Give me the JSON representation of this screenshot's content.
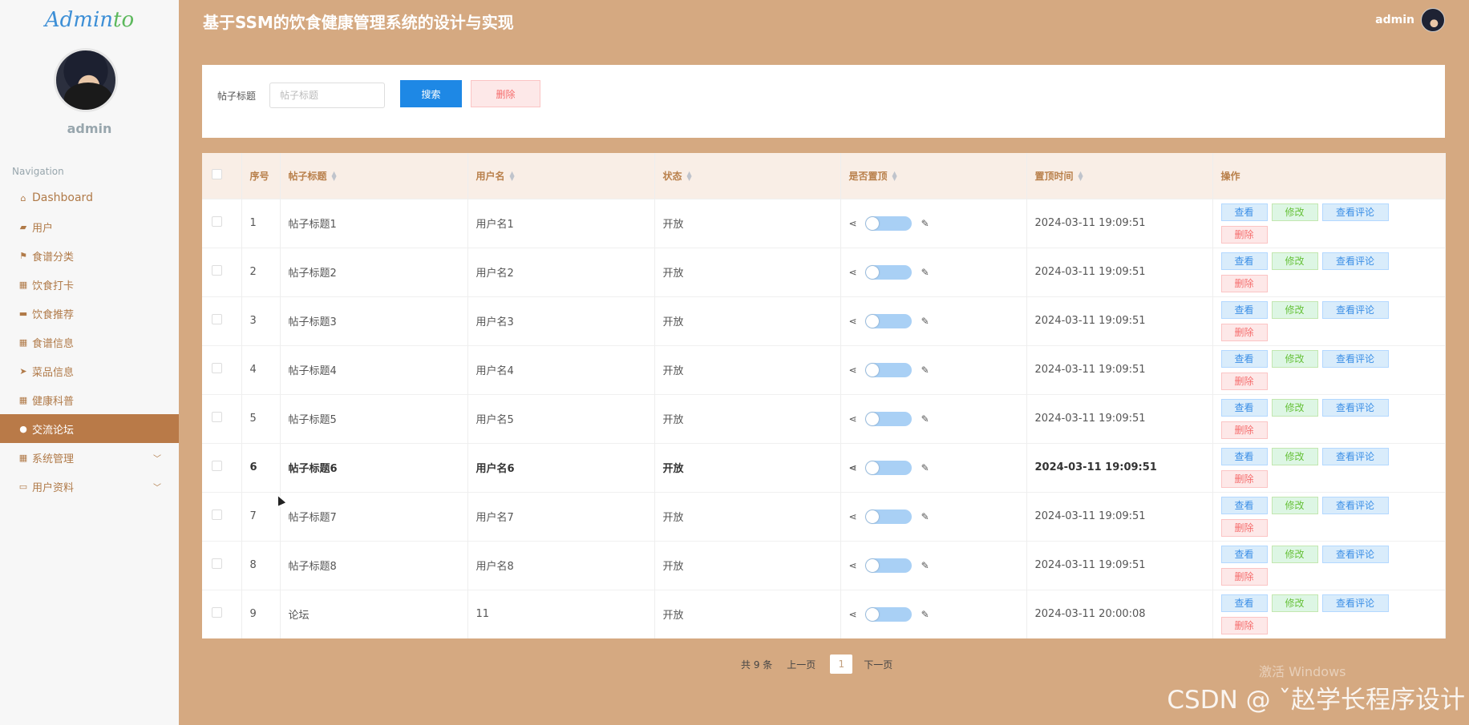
{
  "app": {
    "logo": "Adminto",
    "logo_main": "Admin",
    "logo_accent": "to",
    "title": "基于SSM的饮食健康管理系统的设计与实现"
  },
  "user": {
    "name": "admin"
  },
  "sidebar": {
    "heading": "Navigation",
    "items": [
      {
        "label": "Dashboard",
        "icon": "home-icon"
      },
      {
        "label": "用户",
        "icon": "thumb-icon"
      },
      {
        "label": "食谱分类",
        "icon": "flag-icon"
      },
      {
        "label": "饮食打卡",
        "icon": "grid-icon"
      },
      {
        "label": "饮食推荐",
        "icon": "comment-icon"
      },
      {
        "label": "食谱信息",
        "icon": "grid-icon"
      },
      {
        "label": "菜品信息",
        "icon": "send-icon"
      },
      {
        "label": "健康科普",
        "icon": "grid-icon"
      },
      {
        "label": "交流论坛",
        "icon": "pin-icon",
        "active": true
      },
      {
        "label": "系统管理",
        "icon": "grid-icon",
        "expandable": true
      },
      {
        "label": "用户资料",
        "icon": "card-icon",
        "expandable": true
      }
    ]
  },
  "search": {
    "label": "帖子标题",
    "placeholder": "帖子标题",
    "search_button": "搜索",
    "delete_button": "删除"
  },
  "table": {
    "headers": [
      "序号",
      "帖子标题",
      "用户名",
      "状态",
      "是否置顶",
      "置顶时间",
      "操作"
    ],
    "actions": {
      "view": "查看",
      "edit": "修改",
      "comments": "查看评论",
      "delete": "删除"
    },
    "rows": [
      {
        "index": "1",
        "title": "帖子标题1",
        "username": "用户名1",
        "status": "开放",
        "pin_time": "2024-03-11 19:09:51"
      },
      {
        "index": "2",
        "title": "帖子标题2",
        "username": "用户名2",
        "status": "开放",
        "pin_time": "2024-03-11 19:09:51"
      },
      {
        "index": "3",
        "title": "帖子标题3",
        "username": "用户名3",
        "status": "开放",
        "pin_time": "2024-03-11 19:09:51"
      },
      {
        "index": "4",
        "title": "帖子标题4",
        "username": "用户名4",
        "status": "开放",
        "pin_time": "2024-03-11 19:09:51"
      },
      {
        "index": "5",
        "title": "帖子标题5",
        "username": "用户名5",
        "status": "开放",
        "pin_time": "2024-03-11 19:09:51"
      },
      {
        "index": "6",
        "title": "帖子标题6",
        "username": "用户名6",
        "status": "开放",
        "pin_time": "2024-03-11 19:09:51",
        "hovered": true
      },
      {
        "index": "7",
        "title": "帖子标题7",
        "username": "用户名7",
        "status": "开放",
        "pin_time": "2024-03-11 19:09:51"
      },
      {
        "index": "8",
        "title": "帖子标题8",
        "username": "用户名8",
        "status": "开放",
        "pin_time": "2024-03-11 19:09:51"
      },
      {
        "index": "9",
        "title": "论坛",
        "username": "11",
        "status": "开放",
        "pin_time": "2024-03-11 20:00:08"
      }
    ]
  },
  "pagination": {
    "total": "共 9 条",
    "prev": "上一页",
    "current": "1",
    "next": "下一页"
  },
  "overlay": {
    "activate_windows": "激活 Windows",
    "watermark": "CSDN @ ˇ赵学长程序设计"
  },
  "colors": {
    "background": "#d5a981",
    "active_nav": "#b97a48",
    "primary": "#1e88e5",
    "danger": "#f56c6c",
    "success": "#67c23a"
  }
}
